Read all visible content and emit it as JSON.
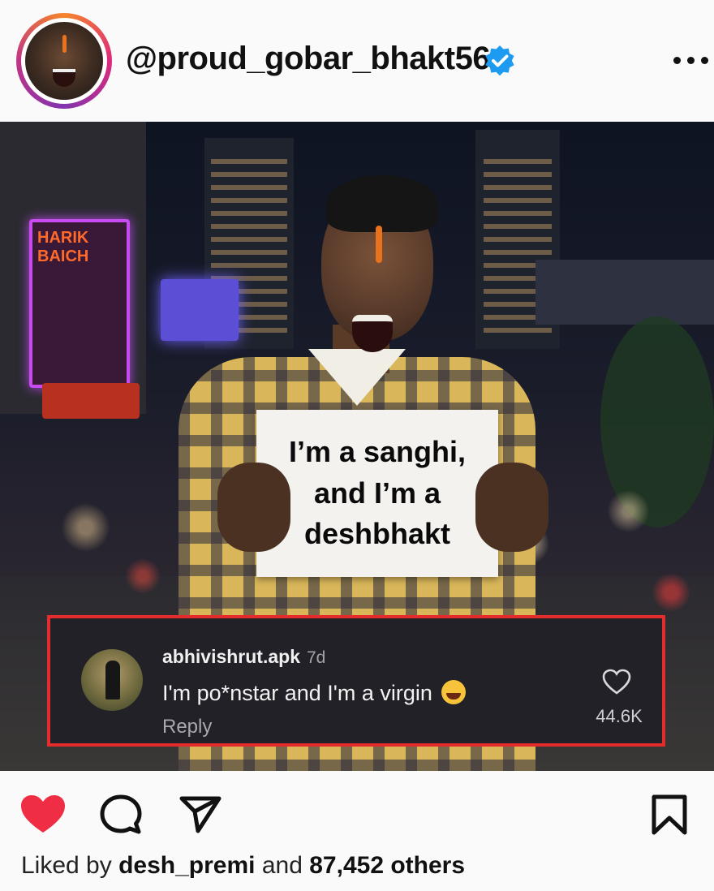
{
  "post": {
    "username": "@proud_gobar_bhakt56",
    "verified": true,
    "image": {
      "placard_text": "I’m a sanghi,\nand I’m a\ndeshbhakt",
      "neon_sign": "HARIK BAICH"
    },
    "liked_by": {
      "prefix": "Liked by",
      "user": "desh_premi",
      "joiner": "and",
      "count_text": "87,452 others"
    }
  },
  "comment": {
    "username": "abhivishrut.apk",
    "time": "7d",
    "text": "I'm po*nstar and I'm a virgin",
    "emoji": "face-with-tears-of-joy",
    "reply_label": "Reply",
    "like_count": "44.6K",
    "highlight_color": "#e42c2c"
  },
  "icons": {
    "verified": "verified-badge-icon",
    "more": "more-options-icon",
    "like": "heart-icon",
    "comment": "comment-icon",
    "share": "send-icon",
    "save": "bookmark-icon"
  },
  "colors": {
    "liked_heart": "#ef2d44",
    "verified_blue": "#1d9bf0",
    "comment_bg": "#212127"
  }
}
